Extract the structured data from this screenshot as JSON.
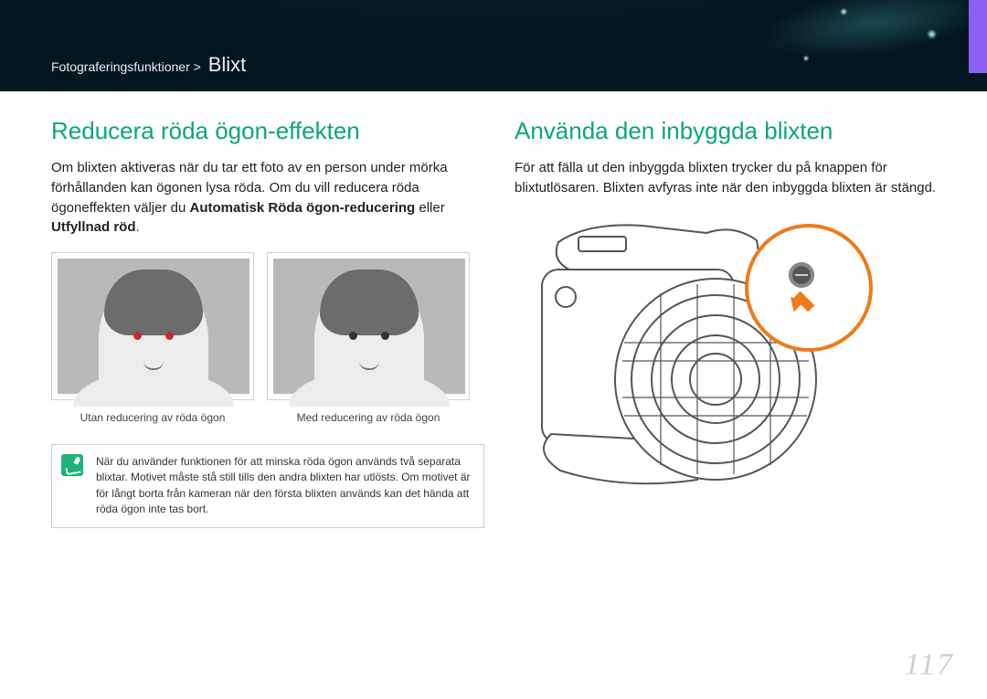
{
  "breadcrumb": {
    "section": "Fotograferingsfunktioner >",
    "page": "Blixt"
  },
  "left": {
    "heading": "Reducera röda ögon-effekten",
    "para1": "Om blixten aktiveras när du tar ett foto av en person under mörka förhållanden kan ögonen lysa röda. Om du vill reducera röda ögoneffekten väljer du ",
    "bold1": "Automatisk Röda ögon-reducering",
    "mid": " eller ",
    "bold2": "Utfyllnad röd",
    "tail": ".",
    "caption_without": "Utan reducering av röda ögon",
    "caption_with": "Med reducering av röda ögon",
    "note": "När du använder funktionen för att minska röda ögon används två separata blixtar. Motivet måste stå still tills den andra blixten har utlösts. Om motivet är för långt borta från kameran när den första blixten används kan det hända att röda ögon inte tas bort."
  },
  "right": {
    "heading": "Använda den inbyggda blixten",
    "para": "För att fälla ut den inbyggda blixten trycker du på knappen för blixtutlösaren. Blixten avfyras inte när den inbyggda blixten är stängd."
  },
  "icons": {
    "note": "pen-note-icon",
    "camera": "camera-illustration",
    "flash_button": "flash-release-button-icon",
    "pointer_arrow": "orange-arrow-icon"
  },
  "page_number": "117"
}
